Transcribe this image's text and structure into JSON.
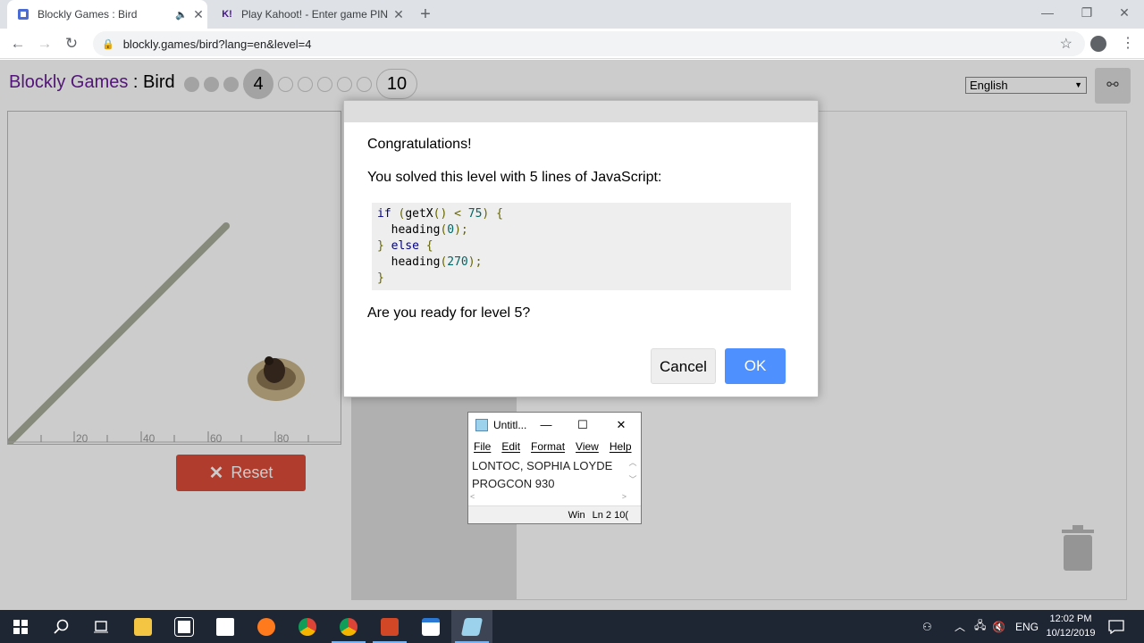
{
  "browser": {
    "tabs": [
      {
        "title": "Blockly Games : Bird",
        "favicon": "blockly-icon",
        "active": true
      },
      {
        "title": "Play Kahoot! - Enter game PIN he",
        "favicon": "K!",
        "active": false
      }
    ],
    "url": "blockly.games/bird?lang=en&level=4"
  },
  "page": {
    "brand": "Blockly Games",
    "separator": " : ",
    "game": "Bird",
    "current_level": "4",
    "last_level": "10",
    "language": "English",
    "reset_label": "Reset",
    "axis_labels": [
      "20",
      "40",
      "60",
      "80"
    ]
  },
  "dialog": {
    "heading": "Congratulations!",
    "message": "You solved this level with 5 lines of JavaScript:",
    "code_lines": [
      "if (getX() < 75) {",
      "  heading(0);",
      "} else {",
      "  heading(270);",
      "}"
    ],
    "question": "Are you ready for level 5?",
    "cancel_label": "Cancel",
    "ok_label": "OK"
  },
  "notepad": {
    "title": "Untitl...",
    "menu": [
      "File",
      "Edit",
      "Format",
      "View",
      "Help"
    ],
    "line1": "LONTOC, SOPHIA LOYDE",
    "line2": "PROGCON 930",
    "status_enc": "Win",
    "status_pos": "Ln 2 10("
  },
  "taskbar": {
    "language": "ENG",
    "time": "12:02 PM",
    "date": "10/12/2019"
  },
  "colors": {
    "accent": "#4d90fe",
    "reset": "#dd4b39",
    "brand": "#6a1b9a",
    "taskbar": "#1e2533"
  }
}
